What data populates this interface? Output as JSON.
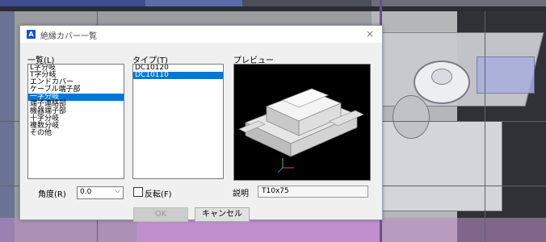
{
  "dialog": {
    "title": "絶縁カバー一覧",
    "close_glyph": "×",
    "list_label": "一覧(L)",
    "type_label": "タイプ(T)",
    "preview_label": "プレビュー",
    "list_items": [
      "L字分岐",
      "T字分岐",
      "エンドカバー",
      "ケーブル端子部",
      "一字分岐",
      "端子連絡部",
      "機器端子部",
      "十字分岐",
      "複数分岐",
      "その他"
    ],
    "list_selected": "一字分岐",
    "type_items": [
      "DC10120",
      "DC10110"
    ],
    "type_selected": "DC10110",
    "angle_label": "角度(R)",
    "angle_value": "0.0",
    "flip_label": "反転(F)",
    "description_label": "説明",
    "description_value": "T10x75",
    "ok_label": "OK",
    "cancel_label": "キャンセル"
  },
  "colors": {
    "selection": "#0078d7",
    "app_icon": "#1a4fd0",
    "dialog_bg": "#f0f0f0"
  }
}
